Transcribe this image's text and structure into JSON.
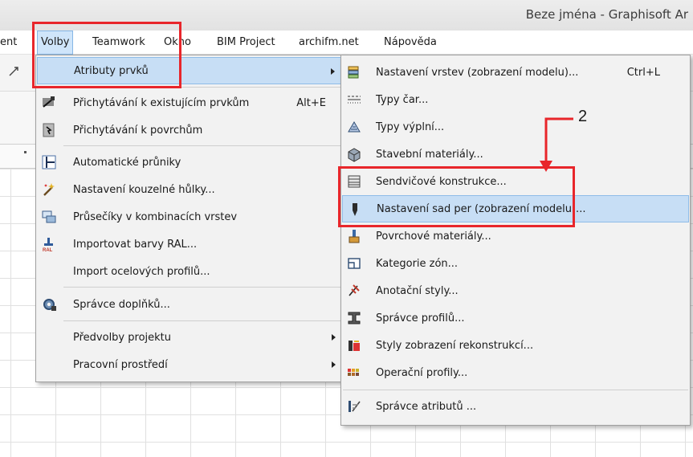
{
  "window": {
    "title": "Beze jména - Graphisoft Ar"
  },
  "menubar": {
    "items": [
      "ent",
      "Volby",
      "Teamwork",
      "Okno",
      "BIM Project",
      "archifm.net",
      "Nápověda"
    ]
  },
  "left_menu": {
    "items": [
      {
        "label": "Atributy prvků",
        "icon": "attributes-folder-icon",
        "submenu": true,
        "highlighted": true
      },
      {
        "label": "Přichytávání k existujícím prvkům",
        "shortcut": "Alt+E",
        "icon": "snap-elements-icon"
      },
      {
        "label": "Přichytávání k povrchům",
        "icon": "snap-surfaces-icon"
      },
      {
        "label": "Automatické průniky",
        "icon": "auto-intersection-icon"
      },
      {
        "label": "Nastavení kouzelné hůlky...",
        "icon": "magic-wand-icon"
      },
      {
        "label": "Průsečíky v kombinacích vrstev",
        "icon": "layer-intersections-icon"
      },
      {
        "label": "Importovat barvy RAL...",
        "icon": "ral-colors-icon"
      },
      {
        "label": "Import ocelových profilů...",
        "icon": "none"
      },
      {
        "label": "Správce doplňků...",
        "icon": "addon-manager-icon"
      },
      {
        "label": "Předvolby projektu",
        "submenu": true
      },
      {
        "label": "Pracovní prostředí",
        "submenu": true
      }
    ]
  },
  "right_menu": {
    "items": [
      {
        "label": "Nastavení vrstev (zobrazení modelu)...",
        "shortcut": "Ctrl+L",
        "icon": "layers-icon"
      },
      {
        "label": "Typy čar...",
        "icon": "line-types-icon"
      },
      {
        "label": "Typy výplní...",
        "icon": "fill-types-icon"
      },
      {
        "label": "Stavební materiály...",
        "icon": "building-materials-icon"
      },
      {
        "label": "Sendvičové konstrukce...",
        "icon": "composites-icon"
      },
      {
        "label": "Nastavení sad per (zobrazení modelu)...",
        "icon": "pen-sets-icon",
        "highlighted": true
      },
      {
        "label": "Povrchové materiály...",
        "icon": "surface-materials-icon"
      },
      {
        "label": "Kategorie zón...",
        "icon": "zone-categories-icon"
      },
      {
        "label": "Anotační styly...",
        "icon": "annotation-styles-icon"
      },
      {
        "label": "Správce profilů...",
        "icon": "profile-manager-icon"
      },
      {
        "label": "Styly zobrazení rekonstrukcí...",
        "icon": "renovation-styles-icon"
      },
      {
        "label": "Operační profily...",
        "icon": "operation-profiles-icon"
      },
      {
        "label": "Správce atributů ...",
        "icon": "attribute-manager-icon"
      }
    ]
  },
  "annotation": {
    "step_number": "2",
    "color": "#e8262b"
  }
}
